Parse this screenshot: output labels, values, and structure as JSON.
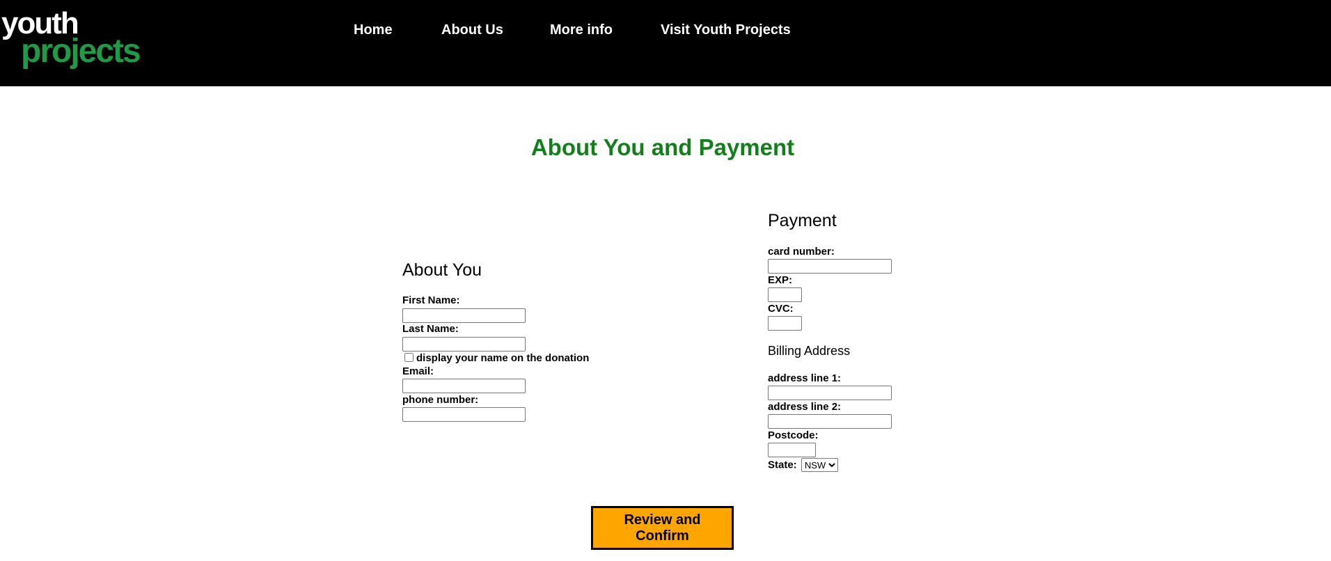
{
  "header": {
    "logo": {
      "line1": "youth",
      "line2": "projects"
    },
    "nav": [
      {
        "label": "Home"
      },
      {
        "label": "About Us"
      },
      {
        "label": "More info"
      },
      {
        "label": "Visit Youth Projects"
      }
    ]
  },
  "page_title": "About You and Payment",
  "about_you": {
    "title": "About You",
    "first_name": {
      "label": "First Name:",
      "value": ""
    },
    "last_name": {
      "label": "Last Name:",
      "value": ""
    },
    "display_name": {
      "label": "display your name on the donation",
      "checked": false
    },
    "email": {
      "label": "Email:",
      "value": ""
    },
    "phone": {
      "label": "phone number:",
      "value": ""
    }
  },
  "payment": {
    "title": "Payment",
    "card_number": {
      "label": "card number:",
      "value": ""
    },
    "exp": {
      "label": "EXP:",
      "value": ""
    },
    "cvc": {
      "label": "CVC:",
      "value": ""
    }
  },
  "billing": {
    "title": "Billing Address",
    "address1": {
      "label": "address line 1:",
      "value": ""
    },
    "address2": {
      "label": "address line 2:",
      "value": ""
    },
    "postcode": {
      "label": "Postcode:",
      "value": ""
    },
    "state": {
      "label": "State:",
      "selected": "NSW"
    }
  },
  "review_button": "Review and Confirm",
  "colors": {
    "header_bg": "#000000",
    "logo_green": "#1f9a46",
    "title_green": "#137f1b",
    "button_bg": "#ffa500"
  }
}
